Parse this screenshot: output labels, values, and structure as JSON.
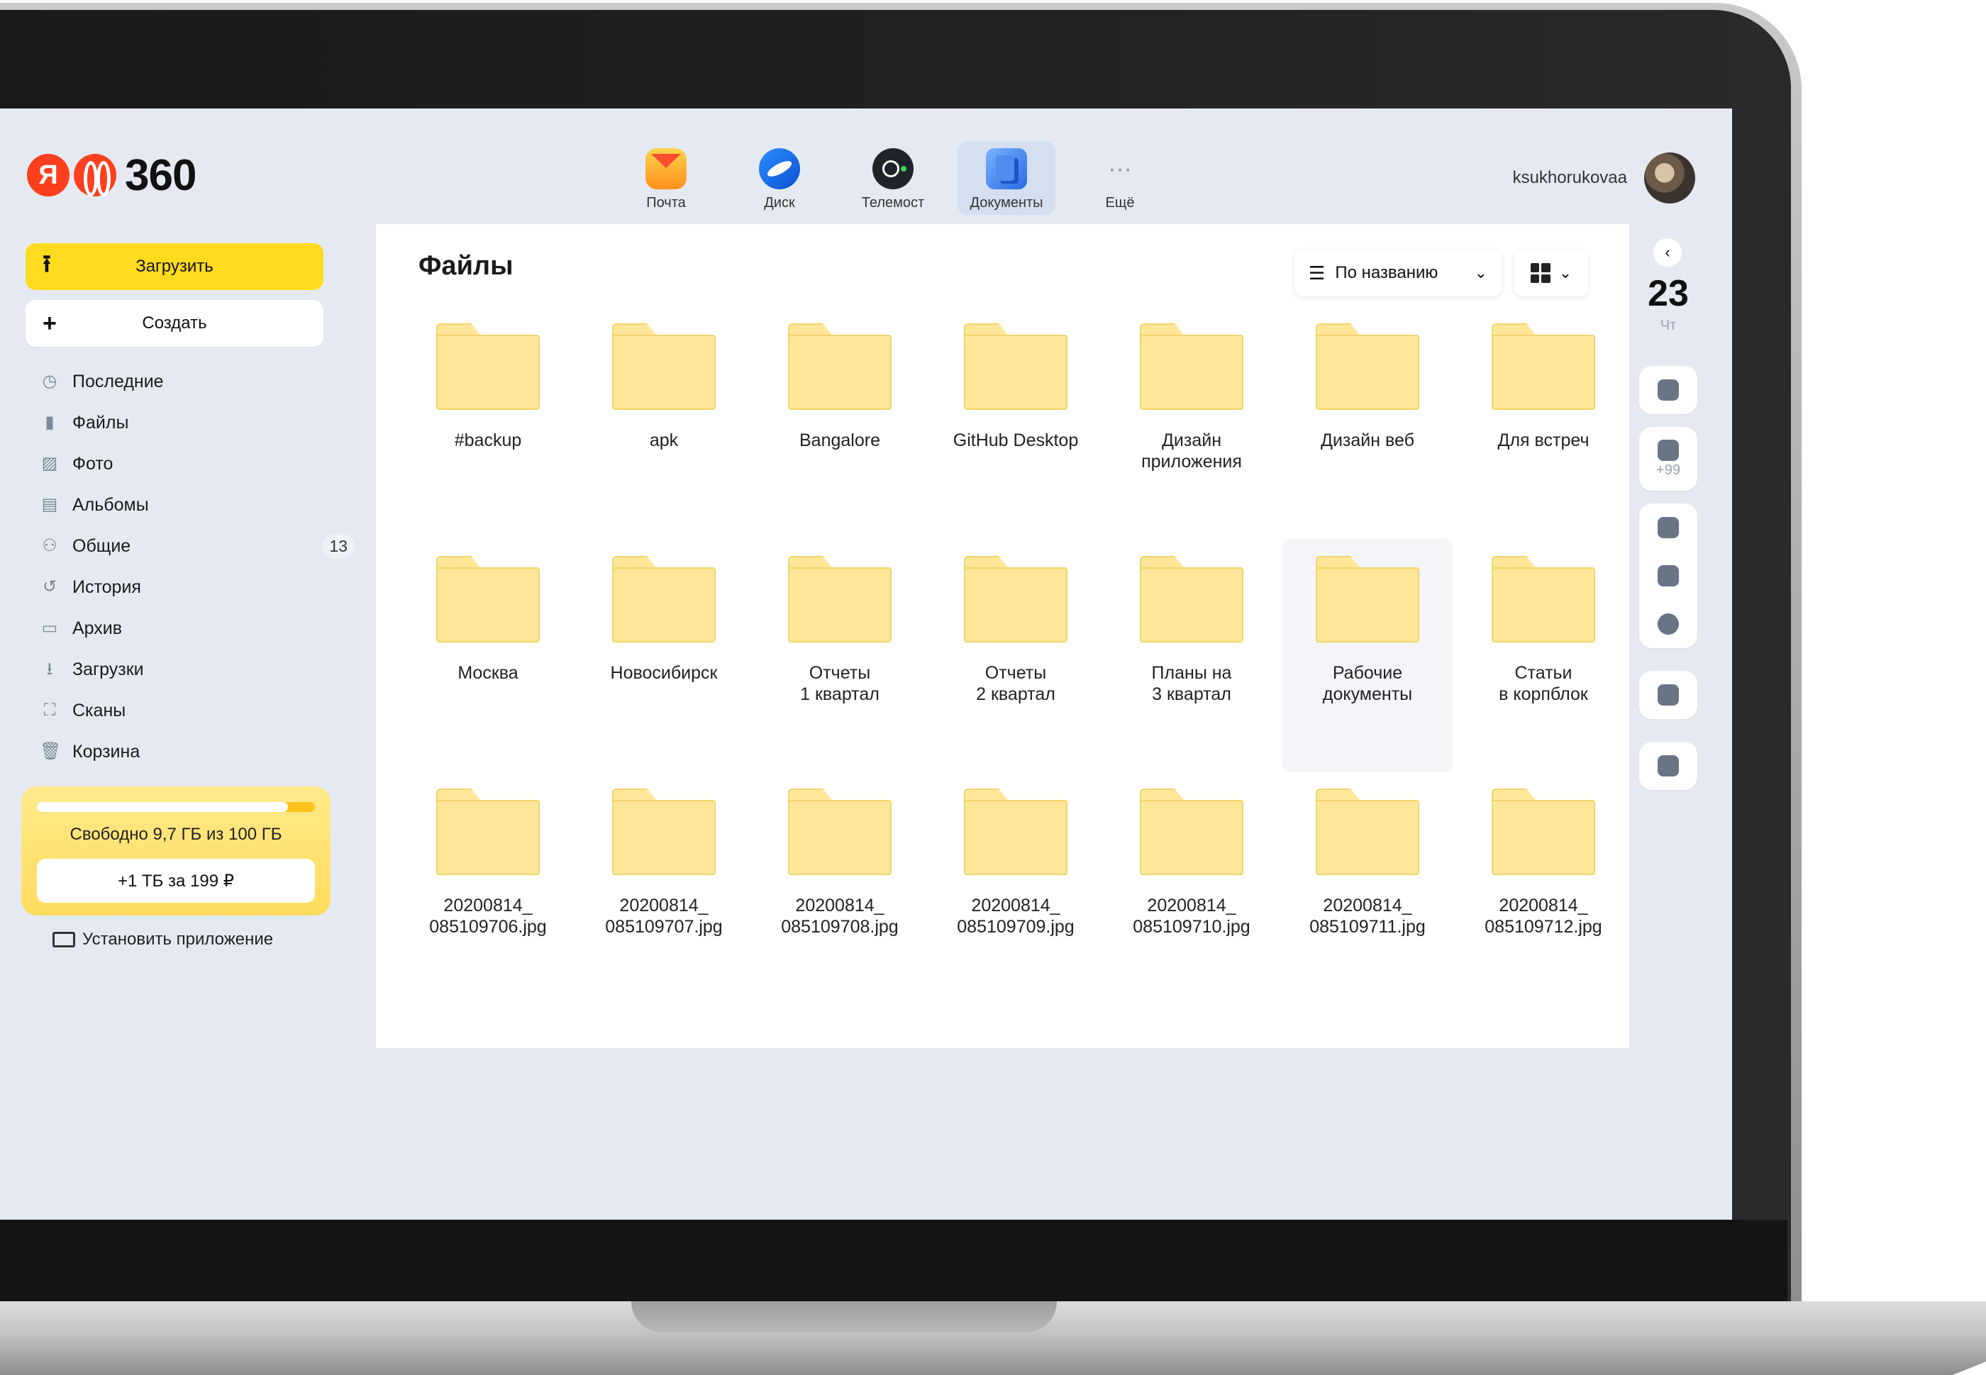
{
  "header": {
    "logo_ya": "Я",
    "logo_number": "360",
    "apps": [
      {
        "label": "Почта",
        "icon": "mail-icon",
        "active": false
      },
      {
        "label": "Диск",
        "icon": "disk-icon",
        "active": false
      },
      {
        "label": "Телемост",
        "icon": "telemost-icon",
        "active": false
      },
      {
        "label": "Документы",
        "icon": "documents-icon",
        "active": true
      },
      {
        "label": "Ещё",
        "icon": "more-icon",
        "active": false
      }
    ],
    "username": "ksukhorukovaa"
  },
  "sidebar": {
    "upload_label": "Загрузить",
    "create_label": "Создать",
    "items": [
      {
        "label": "Последние",
        "icon": "clock-icon"
      },
      {
        "label": "Файлы",
        "icon": "file-icon"
      },
      {
        "label": "Фото",
        "icon": "photo-icon"
      },
      {
        "label": "Альбомы",
        "icon": "albums-icon"
      },
      {
        "label": "Общие",
        "icon": "shared-icon",
        "badge": "13"
      },
      {
        "label": "История",
        "icon": "history-icon"
      },
      {
        "label": "Архив",
        "icon": "archive-icon"
      },
      {
        "label": "Загрузки",
        "icon": "download-icon"
      },
      {
        "label": "Сканы",
        "icon": "scan-icon"
      },
      {
        "label": "Корзина",
        "icon": "trash-icon"
      }
    ],
    "storage": {
      "used_fraction": 0.903,
      "free_text": "Свободно 9,7 ГБ из 100 ГБ",
      "buy_label": "+1 ТБ за 199 ₽"
    },
    "install_label": "Установить приложение"
  },
  "main": {
    "title": "Файлы",
    "sort_label": "По названию",
    "files": [
      {
        "name": "#backup"
      },
      {
        "name": "apk"
      },
      {
        "name": "Bangalore"
      },
      {
        "name": "GitHub Desktop"
      },
      {
        "name": "Дизайн\nприложения"
      },
      {
        "name": "Дизайн веб"
      },
      {
        "name": "Для встреч"
      },
      {
        "name": "Москва"
      },
      {
        "name": "Новосибирск"
      },
      {
        "name": "Отчеты\n1 квартал"
      },
      {
        "name": "Отчеты\n2 квартал"
      },
      {
        "name": "Планы на\n3 квартал"
      },
      {
        "name": "Рабочие\nдокументы",
        "selected": true
      },
      {
        "name": "Статьи\nв корпблок"
      },
      {
        "name": "20200814_\n085109706.jpg"
      },
      {
        "name": "20200814_\n085109707.jpg"
      },
      {
        "name": "20200814_\n085109708.jpg"
      },
      {
        "name": "20200814_\n085109709.jpg"
      },
      {
        "name": "20200814_\n085109710.jpg"
      },
      {
        "name": "20200814_\n085109711.jpg"
      },
      {
        "name": "20200814_\n085109712.jpg"
      }
    ]
  },
  "rail": {
    "day": "23",
    "weekday": "Чт",
    "mail_count": "+99"
  },
  "colors": {
    "accent_yellow": "#ffdb1f",
    "folder_fill": "#ffe79a",
    "screen_bg": "#e5eaf2"
  }
}
